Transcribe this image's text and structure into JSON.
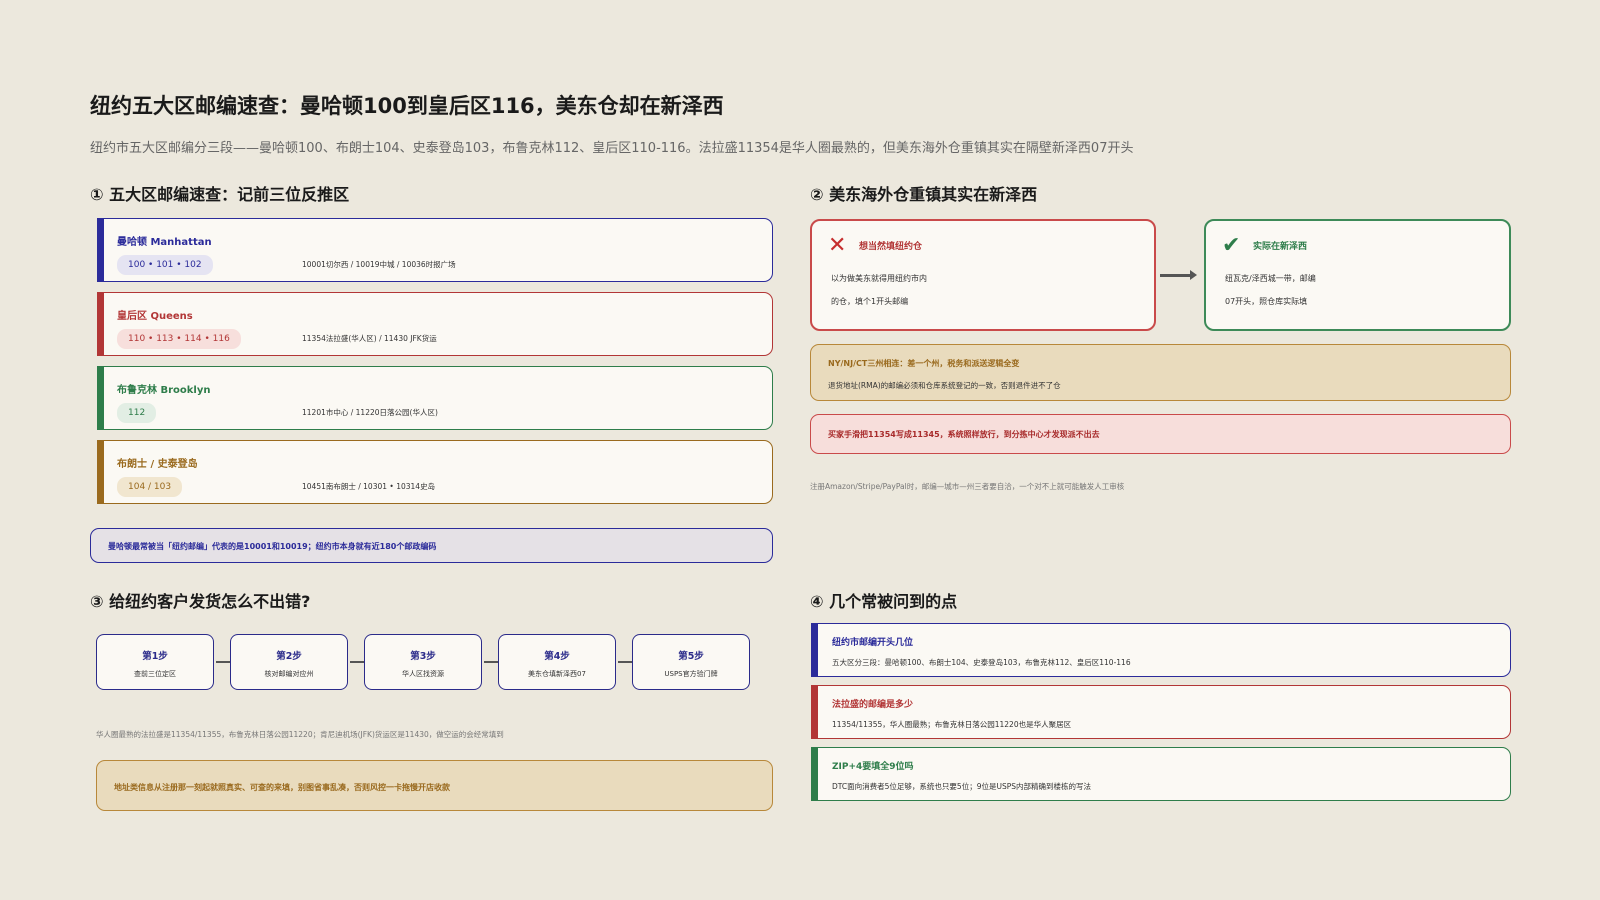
{
  "header": {
    "title": "纽约五大区邮编速查：曼哈顿100到皇后区116，美东仓却在新泽西",
    "subtitle": "纽约市五大区邮编分三段——曼哈顿100、布朗士104、史泰登岛103，布鲁克林112、皇后区110-116。法拉盛11354是华人圈最熟的，但美东海外仓重镇其实在隔壁新泽西07开头"
  },
  "section1": {
    "heading": "① 五大区邮编速查：记前三位反推区",
    "districts": [
      {
        "name": "曼哈顿 Manhattan",
        "prefixes": "100 • 101 • 102",
        "examples": "10001切尔西 / 10019中城 / 10036时报广场",
        "color": "#2b2b9a",
        "pill_bg": "#e5e4f2"
      },
      {
        "name": "皇后区 Queens",
        "prefixes": "110 • 113 • 114 • 116",
        "examples": "11354法拉盛(华人区) / 11430 JFK货运",
        "color": "#b23636",
        "pill_bg": "#f7dfdc"
      },
      {
        "name": "布鲁克林 Brooklyn",
        "prefixes": "112",
        "examples": "11201市中心 / 11220日落公园(华人区)",
        "color": "#2e7d4a",
        "pill_bg": "#e2eee4"
      },
      {
        "name": "布朗士 / 史泰登岛",
        "prefixes": "104 / 103",
        "examples": "10451南布朗士 / 10301 • 10314史岛",
        "color": "#9a6a1e",
        "pill_bg": "#f1e6cf"
      }
    ],
    "note": "曼哈顿最常被当「纽约邮编」代表的是10001和10019；纽约市本身就有近180个邮政编码"
  },
  "section2": {
    "heading": "② 美东海外仓重镇其实在新泽西",
    "wrong": {
      "icon": "cross-icon",
      "title": "想当然填纽约仓",
      "lines": [
        "以为做美东就得用纽约市内",
        "的仓，填个1开头邮编"
      ]
    },
    "right": {
      "icon": "check-icon",
      "title": "实际在新泽西",
      "lines": [
        "纽瓦克/泽西城一带，邮编",
        "07开头，照仓库实际填"
      ]
    },
    "tip_box": {
      "title": "NY/NJ/CT三州相连：差一个州，税务和派送逻辑全变",
      "text": "退货地址(RMA)的邮编必须和仓库系统登记的一致，否则退件进不了仓"
    },
    "warning": "买家手滑把11354写成11345，系统照样放行，到分拣中心才发现派不出去",
    "footnote": "注册Amazon/Stripe/PayPal时，邮编—城市—州三者要自洽，一个对不上就可能触发人工审核"
  },
  "section3": {
    "heading": "③ 给纽约客户发货怎么不出错?",
    "steps": [
      {
        "label": "第1步",
        "desc": "查前三位定区"
      },
      {
        "label": "第2步",
        "desc": "核对邮编对应州"
      },
      {
        "label": "第3步",
        "desc": "华人区找资源"
      },
      {
        "label": "第4步",
        "desc": "美东仓填新泽西07"
      },
      {
        "label": "第5步",
        "desc": "USPS官方验门牌"
      }
    ],
    "footnote": "华人圈最熟的法拉盛是11354/11355，布鲁克林日落公园11220；肯尼迪机场(JFK)货运区是11430，做空运的会经常填到",
    "note": "地址类信息从注册那一刻起就照真实、可查的来填，别图省事乱凑，否则风控一卡拖慢开店收款"
  },
  "section4": {
    "heading": "④ 几个常被问到的点",
    "faqs": [
      {
        "q": "纽约市邮编开头几位",
        "a": "五大区分三段：曼哈顿100、布朗士104、史泰登岛103，布鲁克林112、皇后区110-116",
        "color": "#2b2b9a"
      },
      {
        "q": "法拉盛的邮编是多少",
        "a": "11354/11355，华人圈最熟；布鲁克林日落公园11220也是华人聚居区",
        "color": "#b23636"
      },
      {
        "q": "ZIP+4要填全9位吗",
        "a": "DTC面向消费者5位足够，系统也只要5位；9位是USPS内部精确到楼栋的写法",
        "color": "#2e7d4a"
      }
    ]
  }
}
